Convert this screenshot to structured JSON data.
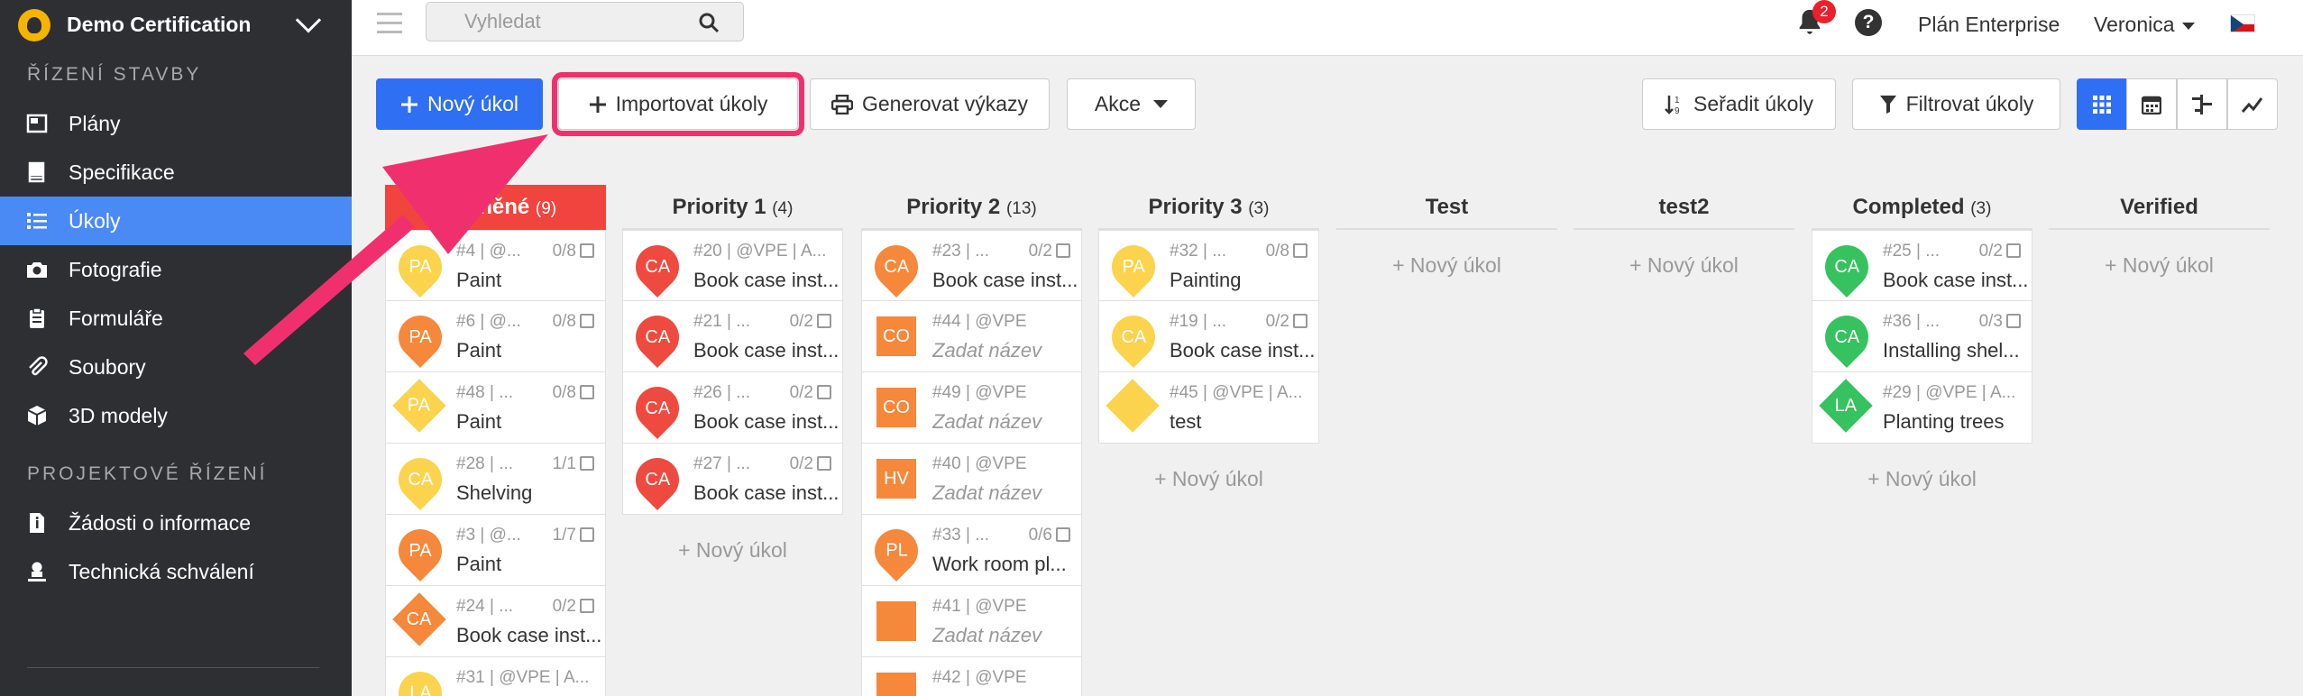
{
  "sidebar": {
    "project": "Demo Certification",
    "section_construction": "ŘÍZENÍ STAVBY",
    "items": [
      {
        "label": "Plány",
        "icon": "blueprint-icon"
      },
      {
        "label": "Specifikace",
        "icon": "book-icon"
      },
      {
        "label": "Úkoly",
        "icon": "list-icon"
      },
      {
        "label": "Fotografie",
        "icon": "camera-icon"
      },
      {
        "label": "Formuláře",
        "icon": "clipboard-icon"
      },
      {
        "label": "Soubory",
        "icon": "paperclip-icon"
      },
      {
        "label": "3D modely",
        "icon": "cube-icon"
      }
    ],
    "section_project": "PROJEKTOVÉ ŘÍZENÍ",
    "items2": [
      {
        "label": "Žádosti o informace",
        "icon": "file-info-icon"
      },
      {
        "label": "Technická schválení",
        "icon": "user-stamp-icon"
      }
    ]
  },
  "topbar": {
    "search_placeholder": "Vyhledat",
    "notification_count": "2",
    "help": "?",
    "plan": "Plán Enterprise",
    "user": "Veronica"
  },
  "toolbar": {
    "new_task": "Nový úkol",
    "import": "Importovat úkoly",
    "generate": "Generovat výkazy",
    "actions": "Akce",
    "sort": "Seřadit úkoly",
    "filter": "Filtrovat úkoly"
  },
  "add_new": "+ Nový úkol",
  "columns": [
    {
      "name": "Změněné",
      "count": "(9)",
      "cards": [
        {
          "meta": "#4 | @...",
          "chk": "0/8",
          "title": "Paint",
          "shape": "pin",
          "color": "c-yl",
          "code": "PA"
        },
        {
          "meta": "#6 | @...",
          "chk": "0/8",
          "title": "Paint",
          "shape": "pin",
          "color": "c-or",
          "code": "PA"
        },
        {
          "meta": "#48 | ...",
          "chk": "0/8",
          "title": "Paint",
          "shape": "dia",
          "color": "c-yl",
          "code": "PA"
        },
        {
          "meta": "#28 | ...",
          "chk": "1/1",
          "title": "Shelving",
          "shape": "pin",
          "color": "c-yl",
          "code": "CA"
        },
        {
          "meta": "#3 | @...",
          "chk": "1/7",
          "title": "Paint",
          "shape": "pin",
          "color": "c-or",
          "code": "PA"
        },
        {
          "meta": "#24 | ...",
          "chk": "0/2",
          "title": "Book case inst...",
          "shape": "dia",
          "color": "c-or",
          "code": "CA"
        },
        {
          "meta": "#31 | @VPE | A...",
          "chk": "",
          "title": "",
          "shape": "pin",
          "color": "c-yl",
          "code": "LA"
        }
      ]
    },
    {
      "name": "Priority 1",
      "count": "(4)",
      "cards": [
        {
          "meta": "#20 | @VPE | A...",
          "chk": "",
          "title": "Book case inst...",
          "shape": "pin",
          "color": "c-rd",
          "code": "CA"
        },
        {
          "meta": "#21 | ...",
          "chk": "0/2",
          "title": "Book case inst...",
          "shape": "pin",
          "color": "c-rd",
          "code": "CA"
        },
        {
          "meta": "#26 | ...",
          "chk": "0/2",
          "title": "Book case inst...",
          "shape": "pin",
          "color": "c-rd",
          "code": "CA"
        },
        {
          "meta": "#27 | ...",
          "chk": "0/2",
          "title": "Book case inst...",
          "shape": "pin",
          "color": "c-rd",
          "code": "CA"
        }
      ]
    },
    {
      "name": "Priority 2",
      "count": "(13)",
      "cards": [
        {
          "meta": "#23 | ...",
          "chk": "0/2",
          "title": "Book case inst...",
          "shape": "pin",
          "color": "c-or",
          "code": "CA"
        },
        {
          "meta": "#44 | @VPE",
          "chk": "",
          "title": "Zadat název",
          "ph": true,
          "shape": "sq",
          "color": "c-or",
          "code": "CO"
        },
        {
          "meta": "#49 | @VPE",
          "chk": "",
          "title": "Zadat název",
          "ph": true,
          "shape": "sq",
          "color": "c-or",
          "code": "CO"
        },
        {
          "meta": "#40 | @VPE",
          "chk": "",
          "title": "Zadat název",
          "ph": true,
          "shape": "sq",
          "color": "c-or",
          "code": "HV"
        },
        {
          "meta": "#33 | ...",
          "chk": "0/6",
          "title": "Work room pl...",
          "shape": "pin",
          "color": "c-or",
          "code": "PL"
        },
        {
          "meta": "#41 | @VPE",
          "chk": "",
          "title": "Zadat název",
          "ph": true,
          "shape": "sq",
          "color": "c-or",
          "code": ""
        },
        {
          "meta": "#42 | @VPE",
          "chk": "",
          "title": "",
          "shape": "sq",
          "color": "c-or",
          "code": ""
        }
      ]
    },
    {
      "name": "Priority 3",
      "count": "(3)",
      "cards": [
        {
          "meta": "#32 | ...",
          "chk": "0/8",
          "title": "Painting",
          "shape": "pin",
          "color": "c-yl",
          "code": "PA"
        },
        {
          "meta": "#19 | ...",
          "chk": "0/2",
          "title": "Book case inst...",
          "shape": "pin",
          "color": "c-yl",
          "code": "CA"
        },
        {
          "meta": "#45 | @VPE | A...",
          "chk": "",
          "title": "test",
          "shape": "dia",
          "color": "c-yl",
          "code": ""
        }
      ]
    },
    {
      "name": "Test",
      "count": "",
      "cards": []
    },
    {
      "name": "test2",
      "count": "",
      "cards": []
    },
    {
      "name": "Completed",
      "count": "(3)",
      "cards": [
        {
          "meta": "#25 | ...",
          "chk": "0/2",
          "title": "Book case inst...",
          "shape": "pin",
          "color": "c-gr",
          "code": "CA"
        },
        {
          "meta": "#36 | ...",
          "chk": "0/3",
          "title": "Installing shel...",
          "shape": "pin",
          "color": "c-gr",
          "code": "CA"
        },
        {
          "meta": "#29 | @VPE | A...",
          "chk": "",
          "title": "Planting trees",
          "shape": "dia",
          "color": "c-gr",
          "code": "LA"
        }
      ]
    },
    {
      "name": "Verified",
      "count": "",
      "cards": []
    }
  ]
}
